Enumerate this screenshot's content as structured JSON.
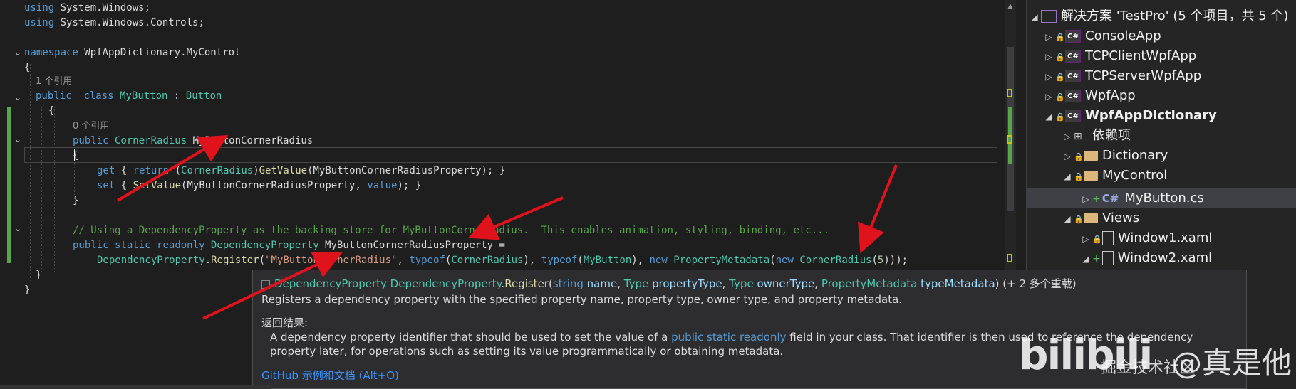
{
  "editor": {
    "lines": [
      {
        "id": "l1",
        "parts": [
          [
            "kw",
            "using"
          ],
          [
            "ide",
            " System.Windows;"
          ]
        ]
      },
      {
        "id": "l2",
        "parts": [
          [
            "kw",
            "using"
          ],
          [
            "ide",
            " System.Windows.Controls;"
          ]
        ]
      },
      {
        "id": "l3",
        "parts": [
          [
            "kw",
            "namespace"
          ],
          [
            "ide",
            " WpfAppDictionary.MyControl"
          ]
        ]
      },
      {
        "id": "l4",
        "parts": [
          [
            "ide",
            "{"
          ]
        ]
      },
      {
        "id": "l5",
        "parts": [
          [
            "lens",
            "1 个引用"
          ]
        ]
      },
      {
        "id": "l6",
        "parts": [
          [
            "kw",
            "public"
          ],
          [
            "ide",
            "  "
          ],
          [
            "kw",
            "class"
          ],
          [
            "ide",
            " "
          ],
          [
            "ty",
            "MyButton"
          ],
          [
            "ide",
            " : "
          ],
          [
            "ty",
            "Button"
          ]
        ]
      },
      {
        "id": "l7",
        "parts": [
          [
            "ide",
            "{"
          ]
        ]
      },
      {
        "id": "l8",
        "parts": [
          [
            "lens",
            "0 个引用"
          ]
        ]
      },
      {
        "id": "l9",
        "parts": [
          [
            "kw",
            "public"
          ],
          [
            "ide",
            " "
          ],
          [
            "ty",
            "CornerRadius"
          ],
          [
            "ide",
            " MyButtonCornerRadius"
          ]
        ]
      },
      {
        "id": "l10",
        "parts": [
          [
            "ide",
            "{"
          ]
        ]
      },
      {
        "id": "l11",
        "parts": [
          [
            "kw",
            "get"
          ],
          [
            "ide",
            " { "
          ],
          [
            "kw",
            "return"
          ],
          [
            "ide",
            " ("
          ],
          [
            "ty",
            "CornerRadius"
          ],
          [
            "ide",
            ")"
          ],
          [
            "fn",
            "GetValue"
          ],
          [
            "ide",
            "(MyButtonCornerRadiusProperty); }"
          ]
        ]
      },
      {
        "id": "l12",
        "parts": [
          [
            "kw",
            "set"
          ],
          [
            "ide",
            " { "
          ],
          [
            "fn",
            "SetValue"
          ],
          [
            "ide",
            "(MyButtonCornerRadiusProperty, "
          ],
          [
            "kw",
            "value"
          ],
          [
            "ide",
            "); }"
          ]
        ]
      },
      {
        "id": "l13",
        "parts": [
          [
            "ide",
            "}"
          ]
        ]
      },
      {
        "id": "l14",
        "parts": [
          [
            "cm",
            "// Using a DependencyProperty as the backing store for MyButtonCornerRadius.  This enables animation, styling, binding, etc..."
          ]
        ]
      },
      {
        "id": "l15",
        "parts": [
          [
            "kw",
            "public"
          ],
          [
            "ide",
            " "
          ],
          [
            "kw",
            "static"
          ],
          [
            "ide",
            " "
          ],
          [
            "kw",
            "readonly"
          ],
          [
            "ide",
            " "
          ],
          [
            "ty",
            "DependencyProperty"
          ],
          [
            "ide",
            " MyButtonCornerRadiusProperty ="
          ]
        ]
      },
      {
        "id": "l16",
        "parts": [
          [
            "ty",
            "DependencyProperty"
          ],
          [
            "ide",
            "."
          ],
          [
            "fn",
            "Register"
          ],
          [
            "ide",
            "("
          ],
          [
            "str",
            "\"MyButtonCornerRadius\""
          ],
          [
            "ide",
            ", "
          ],
          [
            "kw",
            "typeof"
          ],
          [
            "ide",
            "("
          ],
          [
            "ty",
            "CornerRadius"
          ],
          [
            "ide",
            "), "
          ],
          [
            "kw",
            "typeof"
          ],
          [
            "ide",
            "("
          ],
          [
            "ty",
            "MyButton"
          ],
          [
            "ide",
            "), "
          ],
          [
            "kw",
            "new"
          ],
          [
            "ide",
            " "
          ],
          [
            "ty",
            "PropertyMetadata"
          ],
          [
            "ide",
            "("
          ],
          [
            "kw",
            "new"
          ],
          [
            "ide",
            " "
          ],
          [
            "ty",
            "CornerRadius"
          ],
          [
            "ide",
            "("
          ],
          [
            "num",
            "5"
          ],
          [
            "ide",
            ")));"
          ]
        ]
      },
      {
        "id": "l17",
        "parts": [
          [
            "ide",
            "}"
          ]
        ]
      },
      {
        "id": "l18",
        "parts": [
          [
            "ide",
            "}"
          ]
        ]
      }
    ]
  },
  "solution_explorer": {
    "solution_label": "解决方案 'TestPro' (5 个项目，共 5 个)",
    "projects": [
      "ConsoleApp",
      "TCPClientWpfApp",
      "TCPServerWpfApp",
      "WpfApp",
      "WpfAppDictionary"
    ],
    "children": {
      "dependencies": "依赖项",
      "dictionary": "Dictionary",
      "mycontrol": "MyControl",
      "mybutton": "MyButton.cs",
      "views": "Views",
      "window1": "Window1.xaml",
      "window2": "Window2.xaml",
      "partial": "s"
    },
    "cs_badge": "C#"
  },
  "tooltip": {
    "sig_class": "DependencyProperty",
    "sig_type": "DependencyProperty",
    "sig_method": "Register",
    "sig_p1_type": "string",
    "sig_p1": "name",
    "sig_p2_type": "Type",
    "sig_p2": "propertyType",
    "sig_p3_type": "Type",
    "sig_p3": "ownerType",
    "sig_p4_type": "PropertyMetadata",
    "sig_p4": "typeMetadata",
    "sig_overloads": "(+ 2 多个重载)",
    "summary": "Registers a dependency property with the specified property name, property type, owner type, and property metadata.",
    "returns_label": "返回结果:",
    "returns_a": "A dependency property identifier that should be used to set the value of a ",
    "returns_kw": "public static readonly",
    "returns_b": " field in your class. That identifier is then used to reference the dependency property later, for operations such as setting its value programmatically or obtaining metadata.",
    "link": "GitHub 示例和文档 (Alt+O)"
  },
  "watermark": {
    "logo": "bilibili",
    "site": "掘金技术社区",
    "user": "@真是他"
  },
  "colors": {
    "keyword": "#569cd6",
    "type": "#4ec9b0",
    "comment": "#57a64a",
    "string": "#d69d85",
    "arrow": "#e0121b"
  }
}
